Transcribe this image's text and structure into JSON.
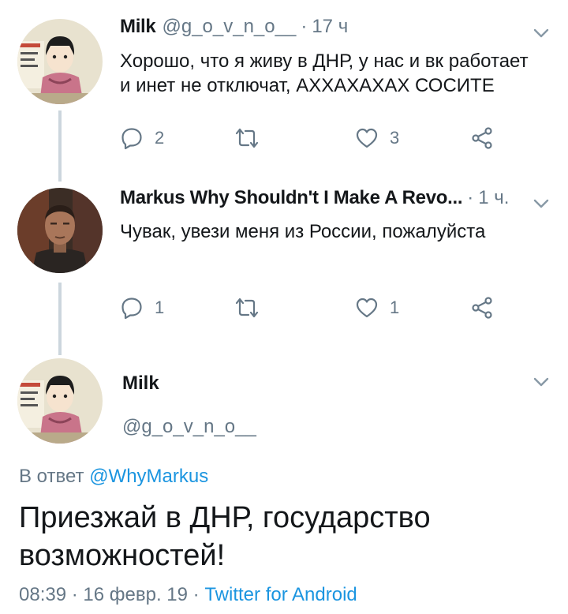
{
  "tweets": [
    {
      "name": "Milk",
      "handle": "@g_o_v_n_o__",
      "separator": "·",
      "time": "17 ч",
      "text_line1": "Хорошо, что я живу в ДНР, у нас и вк работает",
      "text_line2": "и инет не отключат, АХХАХАХАХ СОСИТЕ",
      "replies": "2",
      "likes": "3",
      "avatar_icon": "anime-character-avatar"
    },
    {
      "name": "Markus Why Shouldn't I Make A Revo...",
      "handle": "",
      "separator": "·",
      "time": "1 ч.",
      "text_line1": "Чувак, увези меня из России, пожалуйста",
      "replies": "1",
      "likes": "1",
      "avatar_icon": "game-character-avatar"
    }
  ],
  "main_tweet": {
    "name": "Milk",
    "handle": "@g_o_v_n_o__",
    "reply_prefix": "В ответ",
    "reply_mention": "@WhyMarkus",
    "text_line1": "Приезжай в ДНР, государство",
    "text_line2": "возможностей!",
    "time": "08:39",
    "separator": "·",
    "date": "16 февр. 19",
    "client": "Twitter for Android"
  },
  "colors": {
    "primary_text": "#14171a",
    "secondary_text": "#657786",
    "link": "#1b95e0",
    "thread_line": "#ccd6dd"
  }
}
